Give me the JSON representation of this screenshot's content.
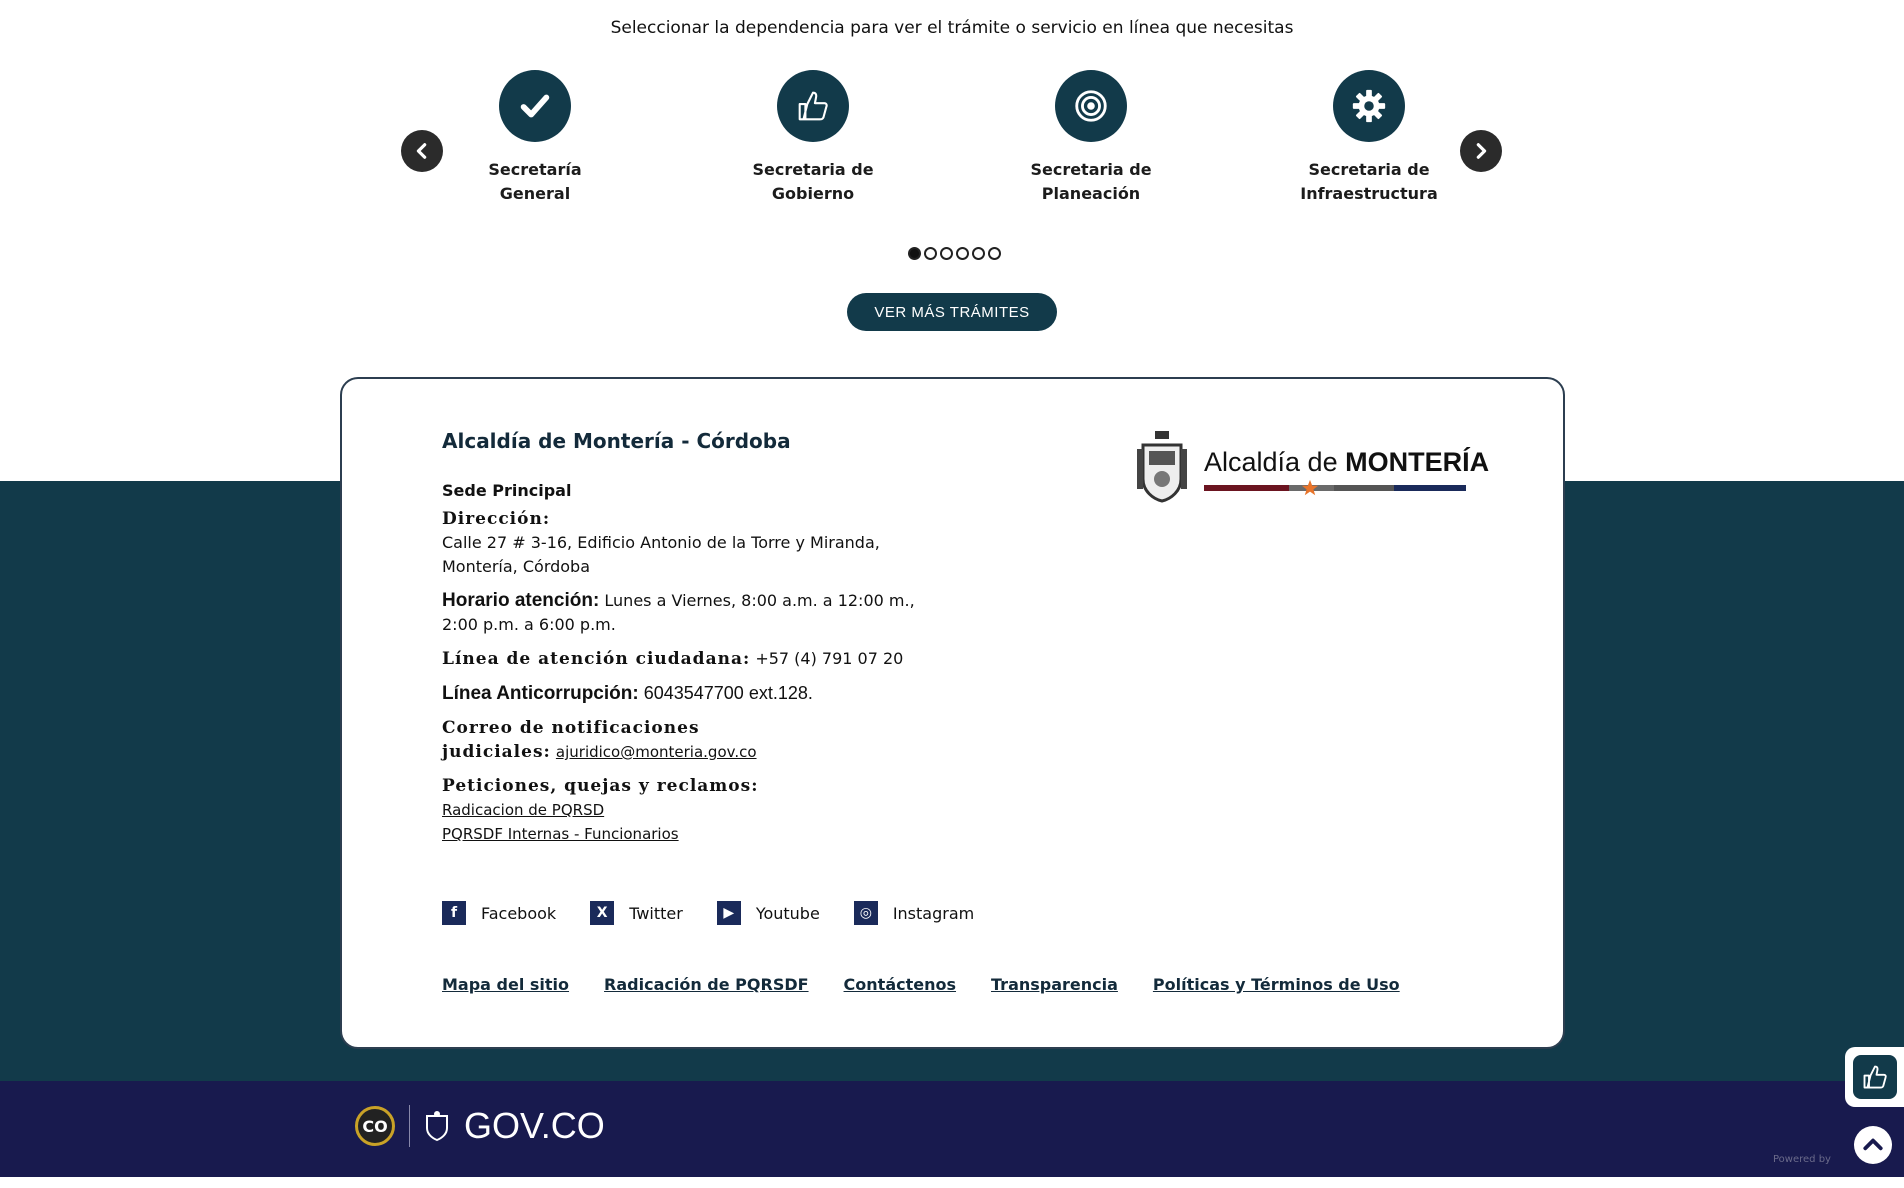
{
  "header": {
    "subtitle": "Seleccionar la dependencia para ver el trámite o servicio en línea que necesitas"
  },
  "dependencies": [
    {
      "label_line1": "Secretaría",
      "label_line2": "General",
      "icon": "check-icon"
    },
    {
      "label_line1": "Secretaria de",
      "label_line2": "Gobierno",
      "icon": "thumbs-up-icon"
    },
    {
      "label_line1": "Secretaria de",
      "label_line2": "Planeación",
      "icon": "target-icon"
    },
    {
      "label_line1": "Secretaria de",
      "label_line2": "Infraestructura",
      "icon": "gear-icon"
    }
  ],
  "carousel": {
    "page_count": 6,
    "active_page": 1
  },
  "more_button": "VER MÁS TRÁMITES",
  "card": {
    "org_name": "Alcaldía de Montería - Córdoba",
    "logo": {
      "text_light": "Alcaldía de ",
      "text_bold": "MONTERÍA"
    },
    "sede": "Sede Principal",
    "direccion_label": "Dirección:",
    "direccion_line1": "Calle 27 # 3-16, Edificio Antonio de la Torre y Miranda,",
    "direccion_line2": "Montería, Córdoba",
    "horario_label": "Horario atención:",
    "horario_value1": " Lunes a Viernes, 8:00 a.m. a 12:00 m.,",
    "horario_value2": "2:00 p.m. a 6:00 p.m.",
    "linea_label": "Línea de atención ciudadana:",
    "linea_value": " +57 (4) 791 07 20",
    "anticorrupcion_label": "Línea Anticorrupción:",
    "anticorrupcion_value": " 6043547700 ext.128.",
    "correo_label1": "Correo de notificaciones",
    "correo_label2": "judiciales:",
    "correo_value": "ajuridico@monteria.gov.co",
    "pqrs_label": "Peticiones, quejas y reclamos:",
    "pqrs_link1": "Radicacion de PQRSD",
    "pqrs_link2": "PQRSDF Internas - Funcionarios"
  },
  "social": [
    {
      "label": "Facebook",
      "glyph": "f"
    },
    {
      "label": "Twitter",
      "glyph": "X"
    },
    {
      "label": "Youtube",
      "glyph": "▶"
    },
    {
      "label": "Instagram",
      "glyph": "◎"
    }
  ],
  "footer_links": [
    "Mapa del sitio",
    "Radicación de PQRSDF",
    "Contáctenos",
    "Transparencia",
    "Políticas y Términos de Uso"
  ],
  "govco": {
    "badge": "CO",
    "text": "GOV.CO"
  },
  "powered_by": "Powered by",
  "colors": {
    "teal": "#123a4a",
    "navy": "#181a4e",
    "accent_orange": "#e8742a"
  }
}
